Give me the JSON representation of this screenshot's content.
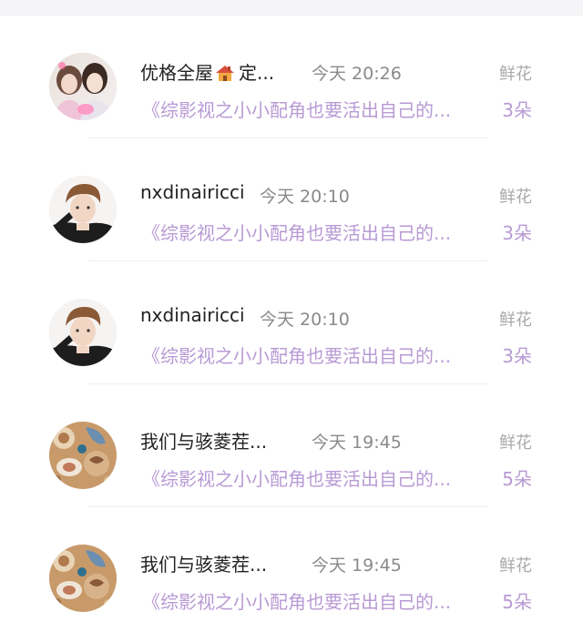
{
  "items": [
    {
      "name": "优格全屋",
      "name_suffix": "定...",
      "has_house_emoji": true,
      "time": "今天 20:26",
      "gift_type": "鲜花",
      "book": "《综影视之小小配角也要活出自己的...",
      "count": "3朵",
      "avatar": "girls-photo"
    },
    {
      "name": "nxdinairicci",
      "time": "今天 20:10",
      "gift_type": "鲜花",
      "book": "《综影视之小小配角也要活出自己的...",
      "count": "3朵",
      "avatar": "boy-photo"
    },
    {
      "name": "nxdinairicci",
      "time": "今天 20:10",
      "gift_type": "鲜花",
      "book": "《综影视之小小配角也要活出自己的...",
      "count": "3朵",
      "avatar": "boy-photo"
    },
    {
      "name": "我们与骇菱茬...",
      "time": "今天 19:45",
      "gift_type": "鲜花",
      "book": "《综影视之小小配角也要活出自己的...",
      "count": "5朵",
      "avatar": "seashells-photo"
    },
    {
      "name": "我们与骇菱茬...",
      "time": "今天 19:45",
      "gift_type": "鲜花",
      "book": "《综影视之小小配角也要活出自己的...",
      "count": "5朵",
      "avatar": "seashells-photo"
    }
  ],
  "colors": {
    "accent_purple": "#b89ad4",
    "name_text": "#222222",
    "meta_text": "#8a8a8a",
    "gift_text": "#a9a9a9"
  }
}
